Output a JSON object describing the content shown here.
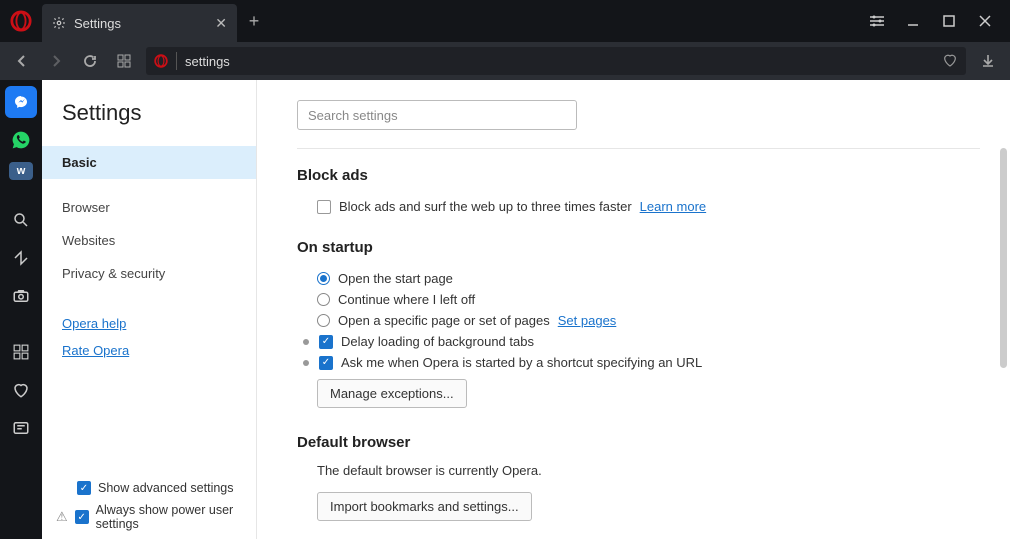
{
  "tab": {
    "title": "Settings"
  },
  "address": {
    "text": "settings"
  },
  "sidebar": {
    "heading": "Settings",
    "items": [
      {
        "label": "Basic",
        "active": true
      },
      {
        "label": "Browser"
      },
      {
        "label": "Websites"
      },
      {
        "label": "Privacy & security"
      }
    ],
    "links": [
      {
        "label": "Opera help"
      },
      {
        "label": "Rate Opera"
      }
    ],
    "advanced": {
      "show_advanced": "Show advanced settings",
      "power_user": "Always show power user settings"
    }
  },
  "main": {
    "search_placeholder": "Search settings",
    "block_ads": {
      "title": "Block ads",
      "checkbox_label": "Block ads and surf the web up to three times faster",
      "learn_more": "Learn more"
    },
    "startup": {
      "title": "On startup",
      "open_start": "Open the start page",
      "continue": "Continue where I left off",
      "specific": "Open a specific page or set of pages",
      "set_pages": "Set pages",
      "delay": "Delay loading of background tabs",
      "ask_me": "Ask me when Opera is started by a shortcut specifying an URL",
      "manage_btn": "Manage exceptions..."
    },
    "default_browser": {
      "title": "Default browser",
      "note": "The default browser is currently Opera.",
      "import_btn": "Import bookmarks and settings..."
    }
  }
}
